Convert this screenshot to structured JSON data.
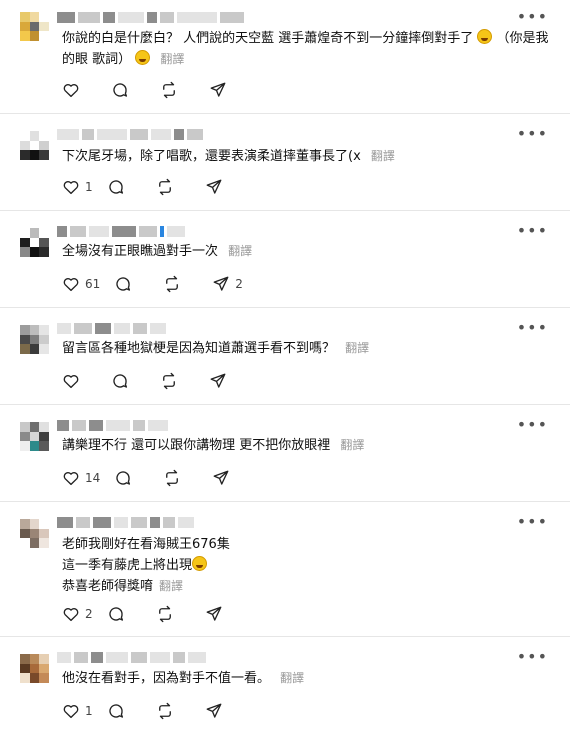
{
  "ui": {
    "more_label": "•••",
    "translate_label": "翻譯"
  },
  "posts": [
    {
      "text": "你說的白是什麼白？ 人們說的天空藍 選手蕭煌奇不到一分鐘摔倒對手了",
      "text_after_emoji": " （你是我的眼 歌詞）",
      "likes": "",
      "replies": "",
      "reposts": "",
      "shares": ""
    },
    {
      "text": "下次尾牙場，除了唱歌，還要表演柔道摔董事長了(x",
      "likes": "1",
      "replies": "",
      "reposts": "",
      "shares": ""
    },
    {
      "text": "全場沒有正眼瞧過對手一次",
      "likes": "61",
      "replies": "",
      "reposts": "",
      "shares": "2"
    },
    {
      "text": "留言區各種地獄梗是因為知道蕭選手看不到嗎？",
      "likes": "",
      "replies": "",
      "reposts": "",
      "shares": ""
    },
    {
      "text": "講樂理不行 還可以跟你講物理 更不把你放眼裡",
      "likes": "14",
      "replies": "",
      "reposts": "",
      "shares": ""
    },
    {
      "lines": [
        "老師我剛好在看海賊王676集",
        "這一季有藤虎上將出現",
        "恭喜老師得獎唷"
      ],
      "likes": "2",
      "replies": "",
      "reposts": "",
      "shares": ""
    },
    {
      "text": "他沒在看對手，因為對手不值一看。",
      "likes": "1",
      "replies": "",
      "reposts": "",
      "shares": ""
    }
  ]
}
